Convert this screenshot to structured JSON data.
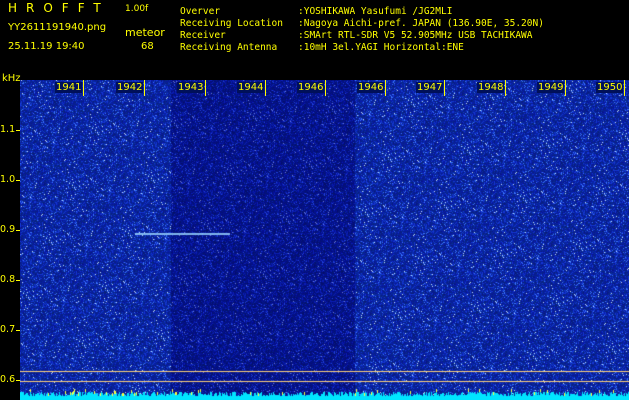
{
  "header": {
    "app_title": "HROFFT",
    "version": "1.00f",
    "filename": "YY2611191940.png",
    "datetime": "25.11.19 19:40",
    "meteor_label": "meteor",
    "meteor_count": "68"
  },
  "info": [
    {
      "key": "Overver",
      "value": ":YOSHIKAWA Yasufumi /JG2MLI"
    },
    {
      "key": "Receiving Location",
      "value": ":Nagoya Aichi-pref. JAPAN (136.90E, 35.20N)"
    },
    {
      "key": "Receiver",
      "value": ":SMArt RTL-SDR V5 52.905MHz USB TACHIKAWA"
    },
    {
      "key": "Receiving Antenna",
      "value": ":10mH 3el.YAGI Horizontal:ENE"
    }
  ],
  "axis": {
    "unit": "kHz",
    "y_ticks": [
      "1.1",
      "1.0",
      "0.9",
      "0.8",
      "0.7",
      "0.6"
    ],
    "x_minutes": [
      "1941",
      "1942",
      "1943",
      "1944",
      "1946",
      "1946",
      "1947",
      "1948",
      "1949",
      "1950"
    ]
  },
  "colors": {
    "background": "#000000",
    "text": "#ffff00",
    "spectrogram_base": "#0a1a8a",
    "spectrogram_noise": "#3a6cff",
    "baseline": "#00e5ff"
  }
}
